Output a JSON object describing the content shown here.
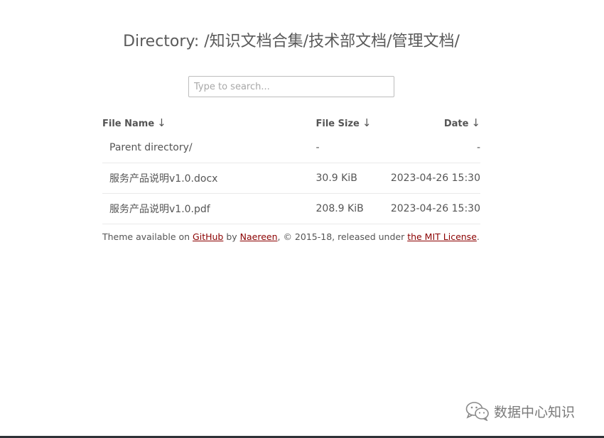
{
  "header": {
    "title": "Directory: /知识文档合集/技术部文档/管理文档/"
  },
  "search": {
    "placeholder": "Type to search..."
  },
  "table": {
    "columns": {
      "name": "File Name",
      "size": "File Size",
      "date": "Date",
      "sort_arrow": "↓"
    },
    "rows": [
      {
        "name": "Parent directory/",
        "size": "-",
        "date": "-"
      },
      {
        "name": "服务产品说明v1.0.docx",
        "size": "30.9 KiB",
        "date": "2023-04-26 15:30"
      },
      {
        "name": "服务产品说明v1.0.pdf",
        "size": "208.9 KiB",
        "date": "2023-04-26 15:30"
      }
    ]
  },
  "footer": {
    "prefix": "Theme available on ",
    "github": "GitHub",
    "by": " by ",
    "author": "Naereen",
    "middle": ", © 2015-18, released under ",
    "license": "the MIT License",
    "suffix": "."
  },
  "watermark": {
    "text": "数据中心知识",
    "icon": "wechat-icon"
  }
}
